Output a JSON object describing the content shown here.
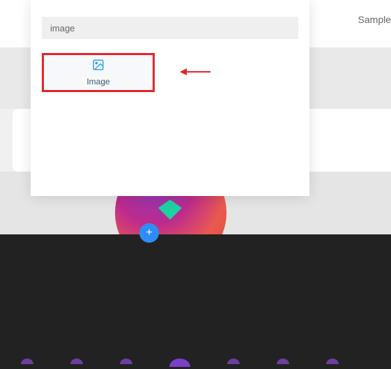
{
  "header": {
    "sample_link": "Sample"
  },
  "modal": {
    "search_value": "image",
    "module": {
      "label": "Image",
      "icon": "image-icon"
    }
  },
  "buttons": {
    "add": "+"
  }
}
